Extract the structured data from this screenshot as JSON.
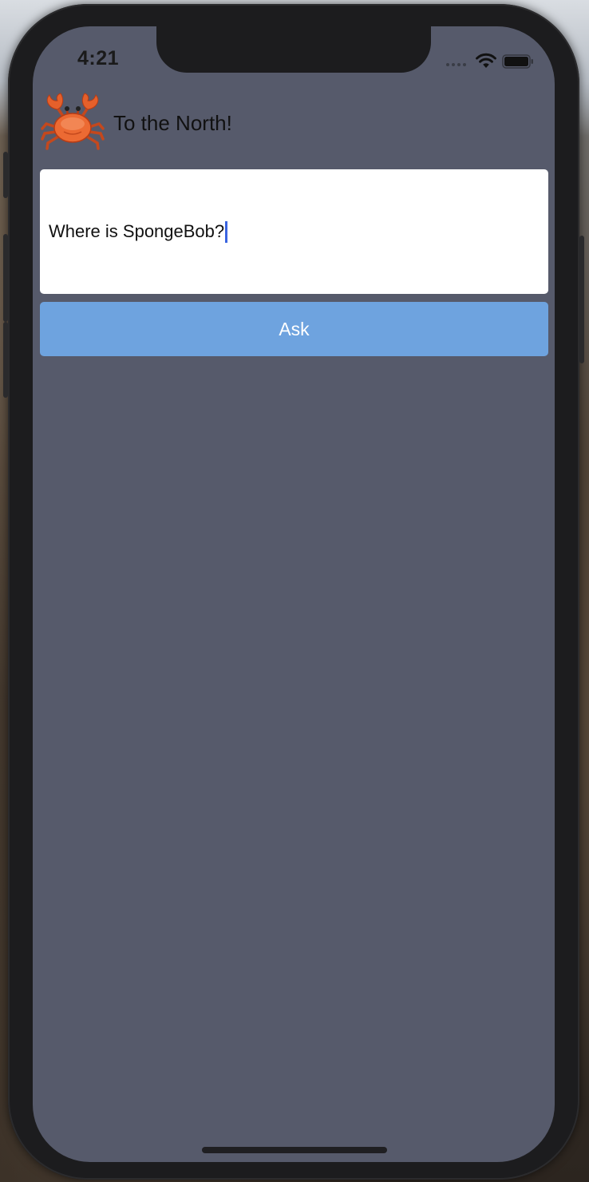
{
  "status_bar": {
    "time": "4:21",
    "icons": [
      "signal-icon",
      "wifi-icon",
      "battery-icon"
    ]
  },
  "header": {
    "icon": "crab-icon",
    "title": "To the North!"
  },
  "question_input": {
    "value": "Where is SpongeBob?"
  },
  "ask_button": {
    "label": "Ask"
  },
  "colors": {
    "screen_background": "#565a6b",
    "button_background": "#6ea3df",
    "button_text": "#ffffff",
    "caret": "#3a64e0"
  }
}
